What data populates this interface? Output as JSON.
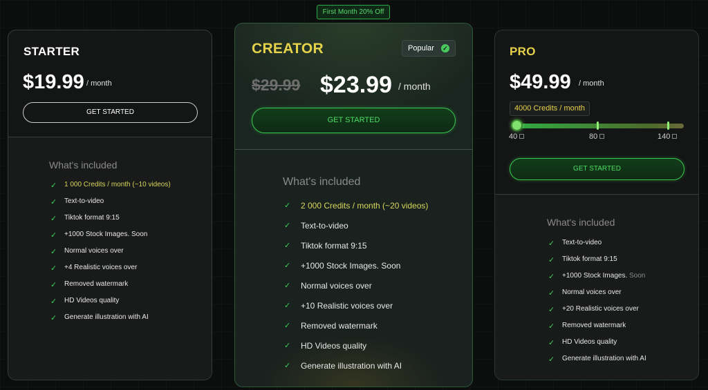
{
  "promo_badge": "First Month 20% Off",
  "starter": {
    "name": "STARTER",
    "price": "$19.99",
    "per": "/ month",
    "button": "GET STARTED",
    "included_title": "What's included",
    "features": [
      {
        "text": "1 000 Credits / month (~10 videos)",
        "highlight": true
      },
      {
        "text": "Text-to-video"
      },
      {
        "text": "Tiktok format 9:15"
      },
      {
        "text": "+1000 Stock Images. Soon"
      },
      {
        "text": "Normal voices over"
      },
      {
        "text": "+4 Realistic voices over"
      },
      {
        "text": "Removed watermark"
      },
      {
        "text": "HD Videos quality"
      },
      {
        "text": "Generate illustration with AI"
      }
    ]
  },
  "creator": {
    "name": "CREATOR",
    "badge": "Popular",
    "old_price": "$29.99",
    "price": "$23.99",
    "per": "/ month",
    "button": "GET STARTED",
    "included_title": "What's included",
    "features": [
      {
        "text": "2 000 Credits / month (~20 videos)",
        "highlight": true
      },
      {
        "text": "Text-to-video"
      },
      {
        "text": "Tiktok format 9:15"
      },
      {
        "text": "+1000 Stock Images. Soon"
      },
      {
        "text": "Normal voices over"
      },
      {
        "text": "+10 Realistic voices over"
      },
      {
        "text": "Removed watermark"
      },
      {
        "text": "HD Videos quality"
      },
      {
        "text": "Generate illustration with AI"
      }
    ]
  },
  "pro": {
    "name": "PRO",
    "price": "$49.99",
    "per": "/ month",
    "credits_label": "4000 Credits / month",
    "slider": {
      "ticks": [
        "40",
        "80",
        "140"
      ],
      "selected": "40"
    },
    "button": "GET STARTED",
    "included_title": "What's included",
    "features": [
      {
        "text": "Text-to-video"
      },
      {
        "text": "Tiktok format 9:15"
      },
      {
        "text": "+1000 Stock Images.",
        "muted_suffix": "Soon"
      },
      {
        "text": "Normal voices over"
      },
      {
        "text": "+20 Realistic voices over"
      },
      {
        "text": "Removed watermark"
      },
      {
        "text": "HD Videos quality"
      },
      {
        "text": "Generate illustration with AI"
      }
    ]
  },
  "colors": {
    "accent_green": "#3ed158",
    "accent_yellow": "#e6d24a",
    "background": "#0c0d0d"
  }
}
